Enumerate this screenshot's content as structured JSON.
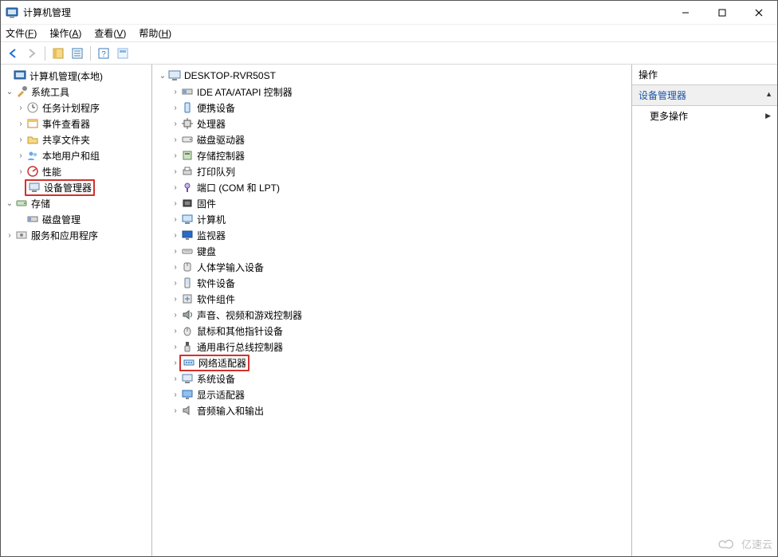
{
  "window": {
    "title": "计算机管理"
  },
  "menu": {
    "file": {
      "label": "文件",
      "key": "F"
    },
    "action": {
      "label": "操作",
      "key": "A"
    },
    "view": {
      "label": "查看",
      "key": "V"
    },
    "help": {
      "label": "帮助",
      "key": "H"
    }
  },
  "left_tree": {
    "root": {
      "label": "计算机管理(本地)",
      "expanded": true
    },
    "system_tools": {
      "label": "系统工具",
      "expanded": true
    },
    "task_scheduler": {
      "label": "任务计划程序"
    },
    "event_viewer": {
      "label": "事件查看器"
    },
    "shared_folders": {
      "label": "共享文件夹"
    },
    "local_users": {
      "label": "本地用户和组"
    },
    "performance": {
      "label": "性能"
    },
    "device_manager": {
      "label": "设备管理器"
    },
    "storage": {
      "label": "存储",
      "expanded": true
    },
    "disk_mgmt": {
      "label": "磁盘管理"
    },
    "services_apps": {
      "label": "服务和应用程序"
    }
  },
  "center_tree": {
    "root": {
      "label": "DESKTOP-RVR50ST",
      "expanded": true
    },
    "items": [
      {
        "k": "ide",
        "label": "IDE ATA/ATAPI 控制器"
      },
      {
        "k": "portable",
        "label": "便携设备"
      },
      {
        "k": "cpu",
        "label": "处理器"
      },
      {
        "k": "diskdrive",
        "label": "磁盘驱动器"
      },
      {
        "k": "storage",
        "label": "存储控制器"
      },
      {
        "k": "printq",
        "label": "打印队列"
      },
      {
        "k": "ports",
        "label": "端口 (COM 和 LPT)"
      },
      {
        "k": "firmware",
        "label": "固件"
      },
      {
        "k": "computer",
        "label": "计算机"
      },
      {
        "k": "monitor",
        "label": "监视器"
      },
      {
        "k": "keyboard",
        "label": "键盘"
      },
      {
        "k": "hid",
        "label": "人体学输入设备"
      },
      {
        "k": "swdev",
        "label": "软件设备"
      },
      {
        "k": "swcomp",
        "label": "软件组件"
      },
      {
        "k": "sound",
        "label": "声音、视频和游戏控制器"
      },
      {
        "k": "mouse",
        "label": "鼠标和其他指针设备"
      },
      {
        "k": "usb",
        "label": "通用串行总线控制器"
      },
      {
        "k": "network",
        "label": "网络适配器"
      },
      {
        "k": "sysdev",
        "label": "系统设备"
      },
      {
        "k": "display",
        "label": "显示适配器"
      },
      {
        "k": "audio",
        "label": "音频输入和输出"
      }
    ]
  },
  "actions": {
    "header": "操作",
    "section": "设备管理器",
    "more": "更多操作"
  },
  "watermark": "亿速云"
}
